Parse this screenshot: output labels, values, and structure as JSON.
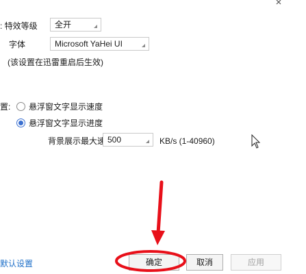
{
  "effects": {
    "level_label": "特效等级",
    "level_value": "全开",
    "font_label": "字体",
    "font_value": "Microsoft YaHei UI",
    "restart_note": "(该设置在迅雷重启后生效)"
  },
  "float_section": {
    "title": "置:",
    "option_speed": "悬浮窗文字显示速度",
    "option_progress": "悬浮窗文字显示进度",
    "selected": "悬浮窗文字显示进度",
    "max_speed_label": "背景展示最大速度",
    "max_speed_value": "500",
    "max_speed_unit": "KB/s (1-40960)"
  },
  "footer": {
    "default_link": "默认设置",
    "ok_label": "确定",
    "cancel_label": "取消",
    "apply_label": "应用"
  },
  "colors": {
    "annotation_red": "#e8101a",
    "link_blue": "#1e6fc8",
    "radio_blue": "#3a6fd0"
  }
}
